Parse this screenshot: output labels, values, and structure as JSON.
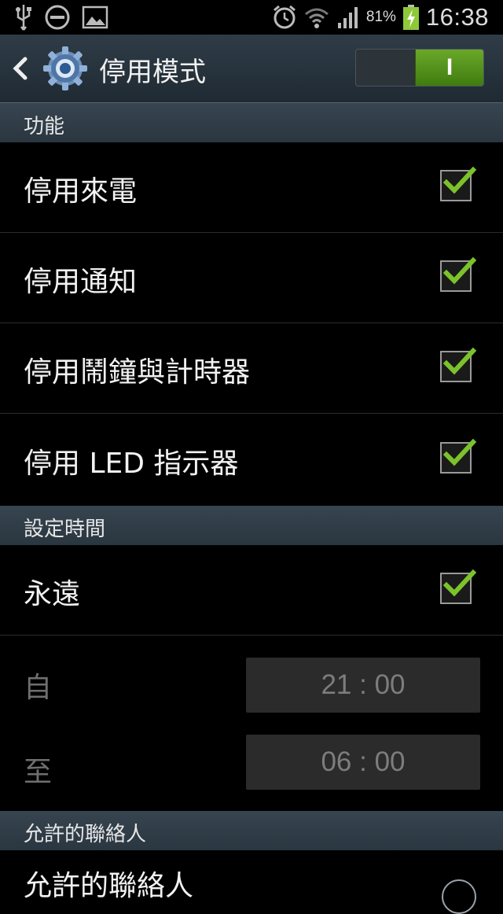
{
  "status_bar": {
    "battery_percent": "81%",
    "time": "16:38",
    "icons": [
      "usb-icon",
      "blocking-mode-icon",
      "image-icon",
      "alarm-icon",
      "wifi-icon",
      "signal-icon",
      "battery-charging-icon"
    ]
  },
  "action_bar": {
    "title": "停用模式",
    "toggle_label": "I",
    "toggle_state": "on"
  },
  "sections": {
    "features_header": "功能",
    "schedule_header": "設定時間",
    "contacts_header": "允許的聯絡人"
  },
  "features": [
    {
      "label": "停用來電",
      "checked": true
    },
    {
      "label": "停用通知",
      "checked": true
    },
    {
      "label": "停用鬧鐘與計時器",
      "checked": true
    },
    {
      "label": "停用 LED 指示器",
      "checked": true
    }
  ],
  "schedule": {
    "always_label": "永遠",
    "always_checked": true,
    "from_label": "自",
    "from_value": "21 : 00",
    "to_label": "至",
    "to_value": "06 : 00"
  },
  "contacts": {
    "row_label": "允許的聯絡人"
  },
  "colors": {
    "accent_green": "#7cc22b",
    "header_bg": "#2f3c47"
  }
}
